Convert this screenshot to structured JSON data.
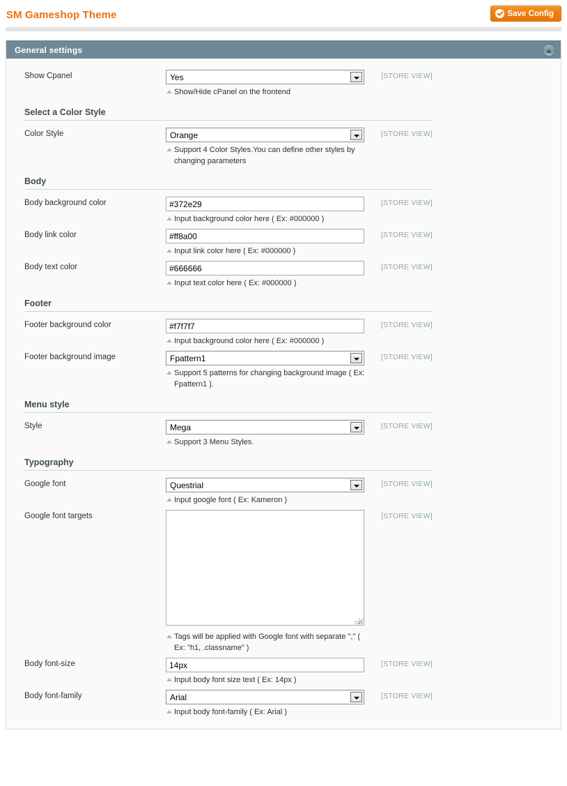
{
  "header": {
    "title": "SM Gameshop Theme",
    "save_label": "Save Config",
    "save_icon": "check-circle-icon"
  },
  "panel": {
    "title": "General settings",
    "collapse_icon": "triangle-up-icon"
  },
  "scope_label": "[STORE VIEW]",
  "sections": [
    {
      "legend": null,
      "fields": [
        {
          "label": "Show Cpanel",
          "type": "select",
          "value": "Yes",
          "note": "Show/Hide cPanel on the frontend",
          "scope": "[STORE VIEW]"
        }
      ]
    },
    {
      "legend": "Select a Color Style",
      "fields": [
        {
          "label": "Color Style",
          "type": "select",
          "value": "Orange",
          "note": "Support 4 Color Styles.You can define other styles by changing parameters",
          "scope": "[STORE VIEW]"
        }
      ]
    },
    {
      "legend": "Body",
      "fields": [
        {
          "label": "Body background color",
          "type": "text",
          "value": "#372e29",
          "note": "Input background color here ( Ex: #000000 )",
          "scope": "[STORE VIEW]"
        },
        {
          "label": "Body link color",
          "type": "text",
          "value": "#ff8a00",
          "note": "Input link color here ( Ex: #000000 )",
          "scope": "[STORE VIEW]"
        },
        {
          "label": "Body text color",
          "type": "text",
          "value": "#666666",
          "note": "Input text color here ( Ex: #000000 )",
          "scope": "[STORE VIEW]"
        }
      ]
    },
    {
      "legend": "Footer",
      "fields": [
        {
          "label": "Footer background color",
          "type": "text",
          "value": "#f7f7f7",
          "note": "Input background color here ( Ex: #000000 )",
          "scope": "[STORE VIEW]"
        },
        {
          "label": "Footer background image",
          "type": "select",
          "value": "Fpattern1",
          "note": "Support 5 patterns for changing background image ( Ex: Fpattern1 ).",
          "scope": "[STORE VIEW]"
        }
      ]
    },
    {
      "legend": "Menu style",
      "fields": [
        {
          "label": "Style",
          "type": "select",
          "value": "Mega",
          "note": "Support 3 Menu Styles.",
          "scope": "[STORE VIEW]"
        }
      ]
    },
    {
      "legend": "Typography",
      "fields": [
        {
          "label": "Google font",
          "type": "select",
          "value": "Questrial",
          "note": "Input google font ( Ex: Kameron )",
          "scope": "[STORE VIEW]"
        },
        {
          "label": "Google font targets",
          "type": "textarea",
          "value": "",
          "note": "Tags will be applied with Google font with separate \",\" ( Ex: \"h1, .classname\" )",
          "scope": "[STORE VIEW]"
        },
        {
          "label": "Body font-size",
          "type": "text",
          "value": "14px",
          "note": "Input body font size text ( Ex: 14px )",
          "scope": "[STORE VIEW]"
        },
        {
          "label": "Body font-family",
          "type": "select",
          "value": "Arial",
          "note": "Input body font-family ( Ex: Arial )",
          "scope": "[STORE VIEW]"
        }
      ]
    }
  ],
  "colors": {
    "accent_orange": "#ef6f0c",
    "panel_header": "#6f8a96",
    "scope_text": "#8fa4b2",
    "panel_bg": "#fafafa"
  }
}
